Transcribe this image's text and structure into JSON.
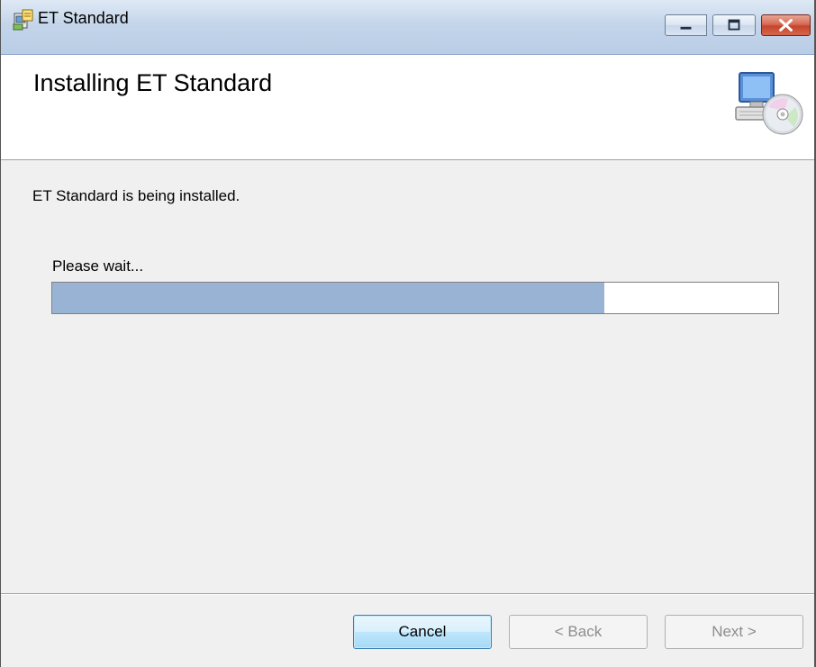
{
  "window": {
    "title": "ET Standard"
  },
  "banner": {
    "title": "Installing ET Standard",
    "icon": "computer-cd-icon"
  },
  "body": {
    "status_text": "ET Standard is being installed.",
    "wait_label": "Please wait...",
    "progress_fraction": 0.76
  },
  "buttons": {
    "cancel": "Cancel",
    "back": "< Back",
    "next": "Next >"
  },
  "colors": {
    "progress_fill": "#98b3d4",
    "close_button": "#c7442a"
  }
}
